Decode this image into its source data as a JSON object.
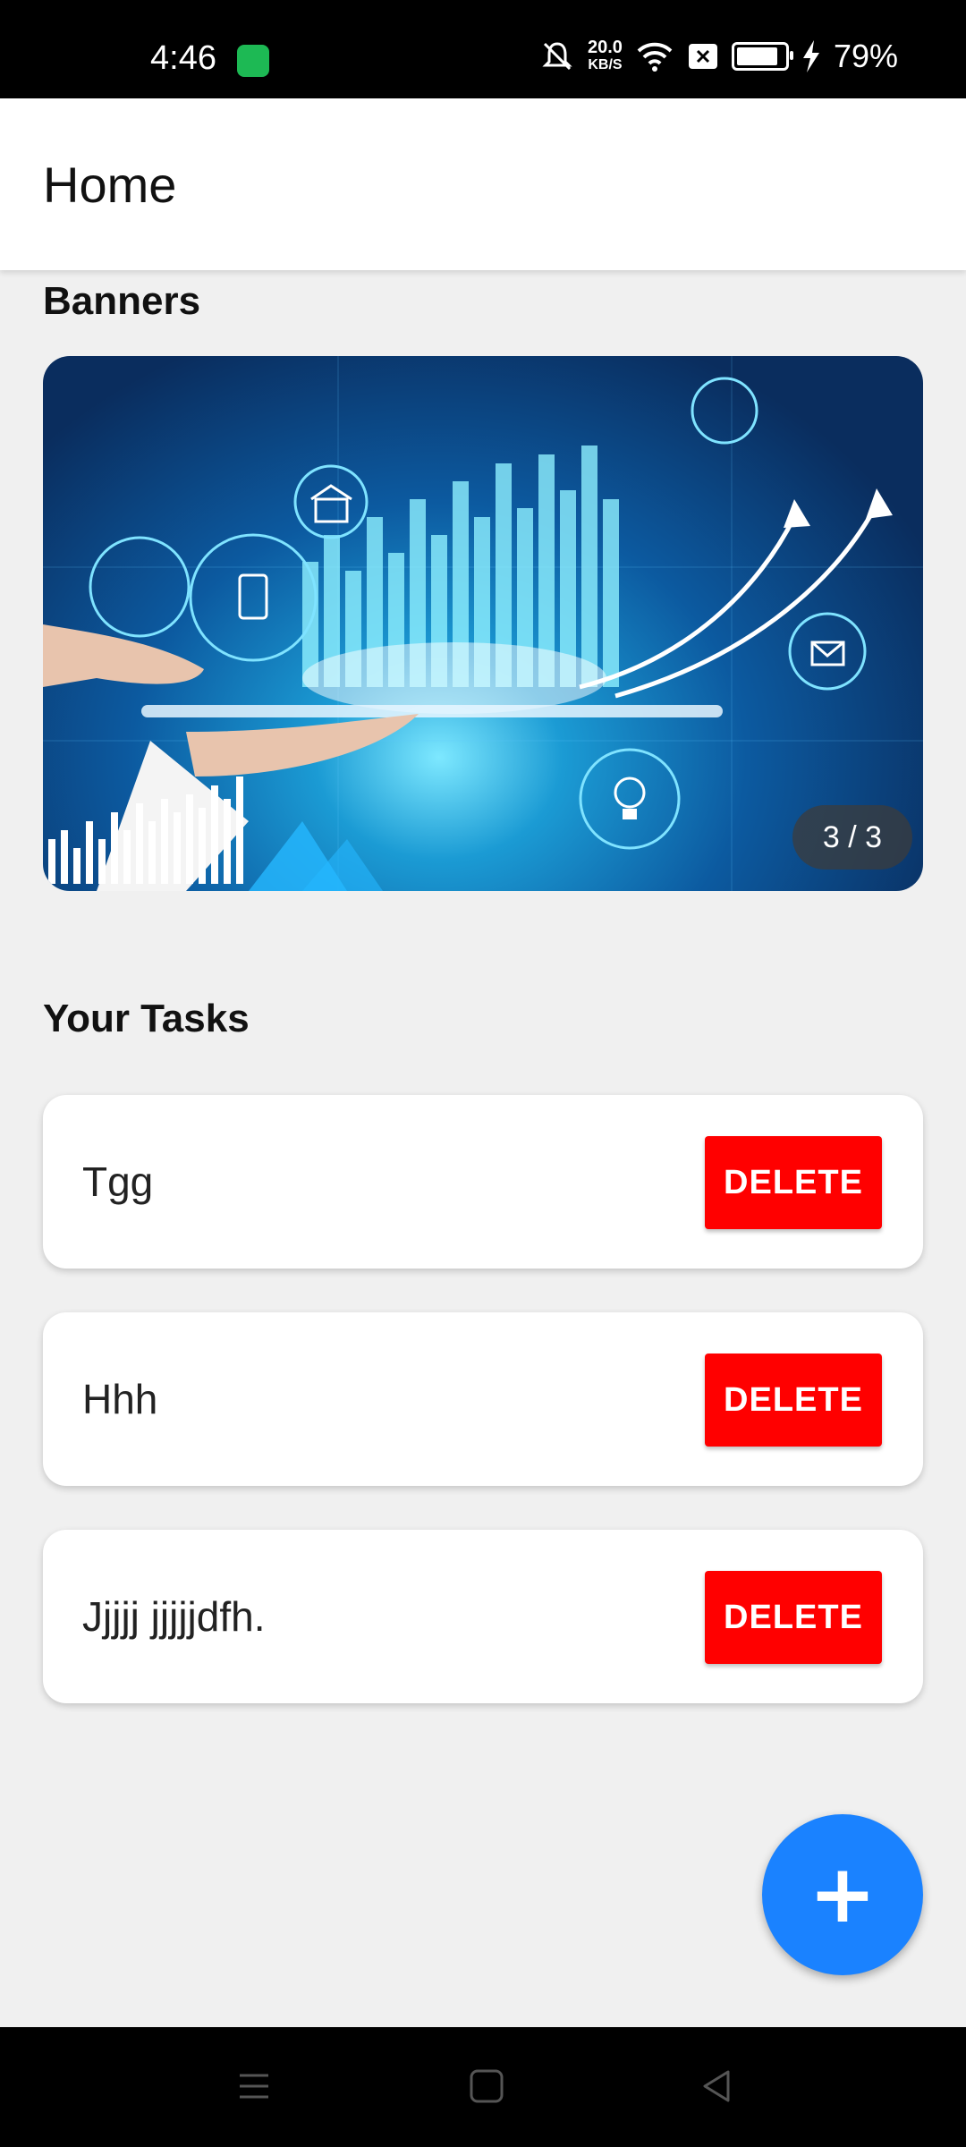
{
  "status_bar": {
    "time": "4:46",
    "speed_value": "20.0",
    "speed_unit": "KB/S",
    "battery_percent": "79%",
    "icons": [
      "app-notification-icon",
      "mute-icon",
      "wifi-icon",
      "sim-x-icon",
      "battery-icon",
      "charging-icon"
    ]
  },
  "app_bar": {
    "title": "Home"
  },
  "banners": {
    "title": "Banners",
    "counter": "3 / 3",
    "current": 3,
    "total": 3
  },
  "tasks": {
    "title": "Your Tasks",
    "delete_label": "DELETE",
    "items": [
      {
        "text": "Tgg"
      },
      {
        "text": "Hhh"
      },
      {
        "text": "Jjjjj jjjjjdfh."
      }
    ]
  },
  "fab": {
    "label": "+",
    "icon": "plus-icon"
  },
  "colors": {
    "accent": "#1a82ff",
    "delete": "#ff0000",
    "background": "#f0f0f0"
  }
}
